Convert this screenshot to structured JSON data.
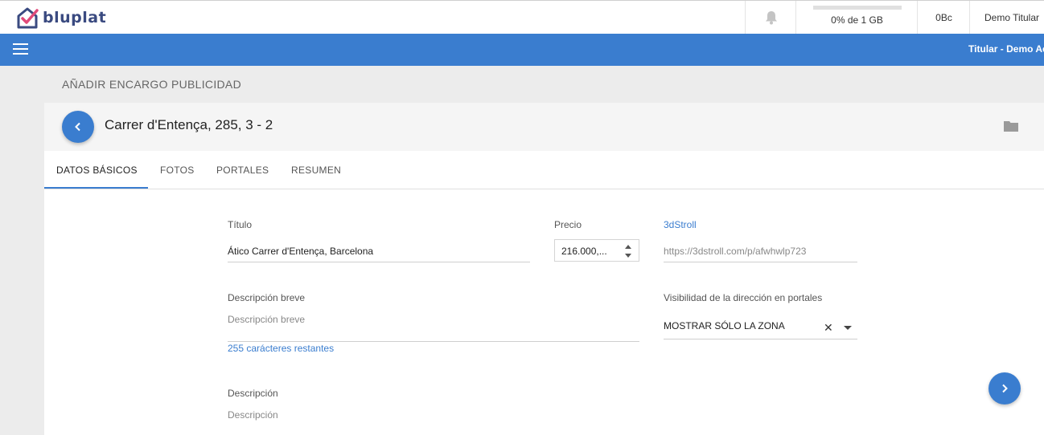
{
  "app": {
    "name": "bluplat"
  },
  "header": {
    "storage_text": "0% de 1 GB",
    "storage_percent": 0,
    "bc_text": "0Bc",
    "user_name": "Demo Titular"
  },
  "nav": {
    "right_text": "Titular - Demo Ac"
  },
  "page": {
    "title": "AÑADIR ENCARGO PUBLICIDAD"
  },
  "card": {
    "address": "Carrer d'Entença, 285, 3 - 2",
    "tabs": [
      {
        "label": "DATOS BÁSICOS",
        "active": true
      },
      {
        "label": "FOTOS",
        "active": false
      },
      {
        "label": "PORTALES",
        "active": false
      },
      {
        "label": "RESUMEN",
        "active": false
      }
    ]
  },
  "form": {
    "titulo": {
      "label": "Título",
      "value": "Ático Carrer d'Entença, Barcelona"
    },
    "precio": {
      "label": "Precio",
      "value": "216.000,..."
    },
    "tdstroll": {
      "label": "3dStroll",
      "placeholder": "https://3dstroll.com/p/afwhwlp723"
    },
    "desc_breve": {
      "label": "Descripción breve",
      "placeholder": "Descripción breve",
      "remaining": "255 carácteres restantes"
    },
    "visibilidad": {
      "label": "Visibilidad de la dirección en portales",
      "value": "MOSTRAR SÓLO LA ZONA"
    },
    "descripcion": {
      "label": "Descripción",
      "placeholder": "Descripción"
    }
  },
  "colors": {
    "primary": "#3a7dcf",
    "logo": "#3a4a80"
  }
}
